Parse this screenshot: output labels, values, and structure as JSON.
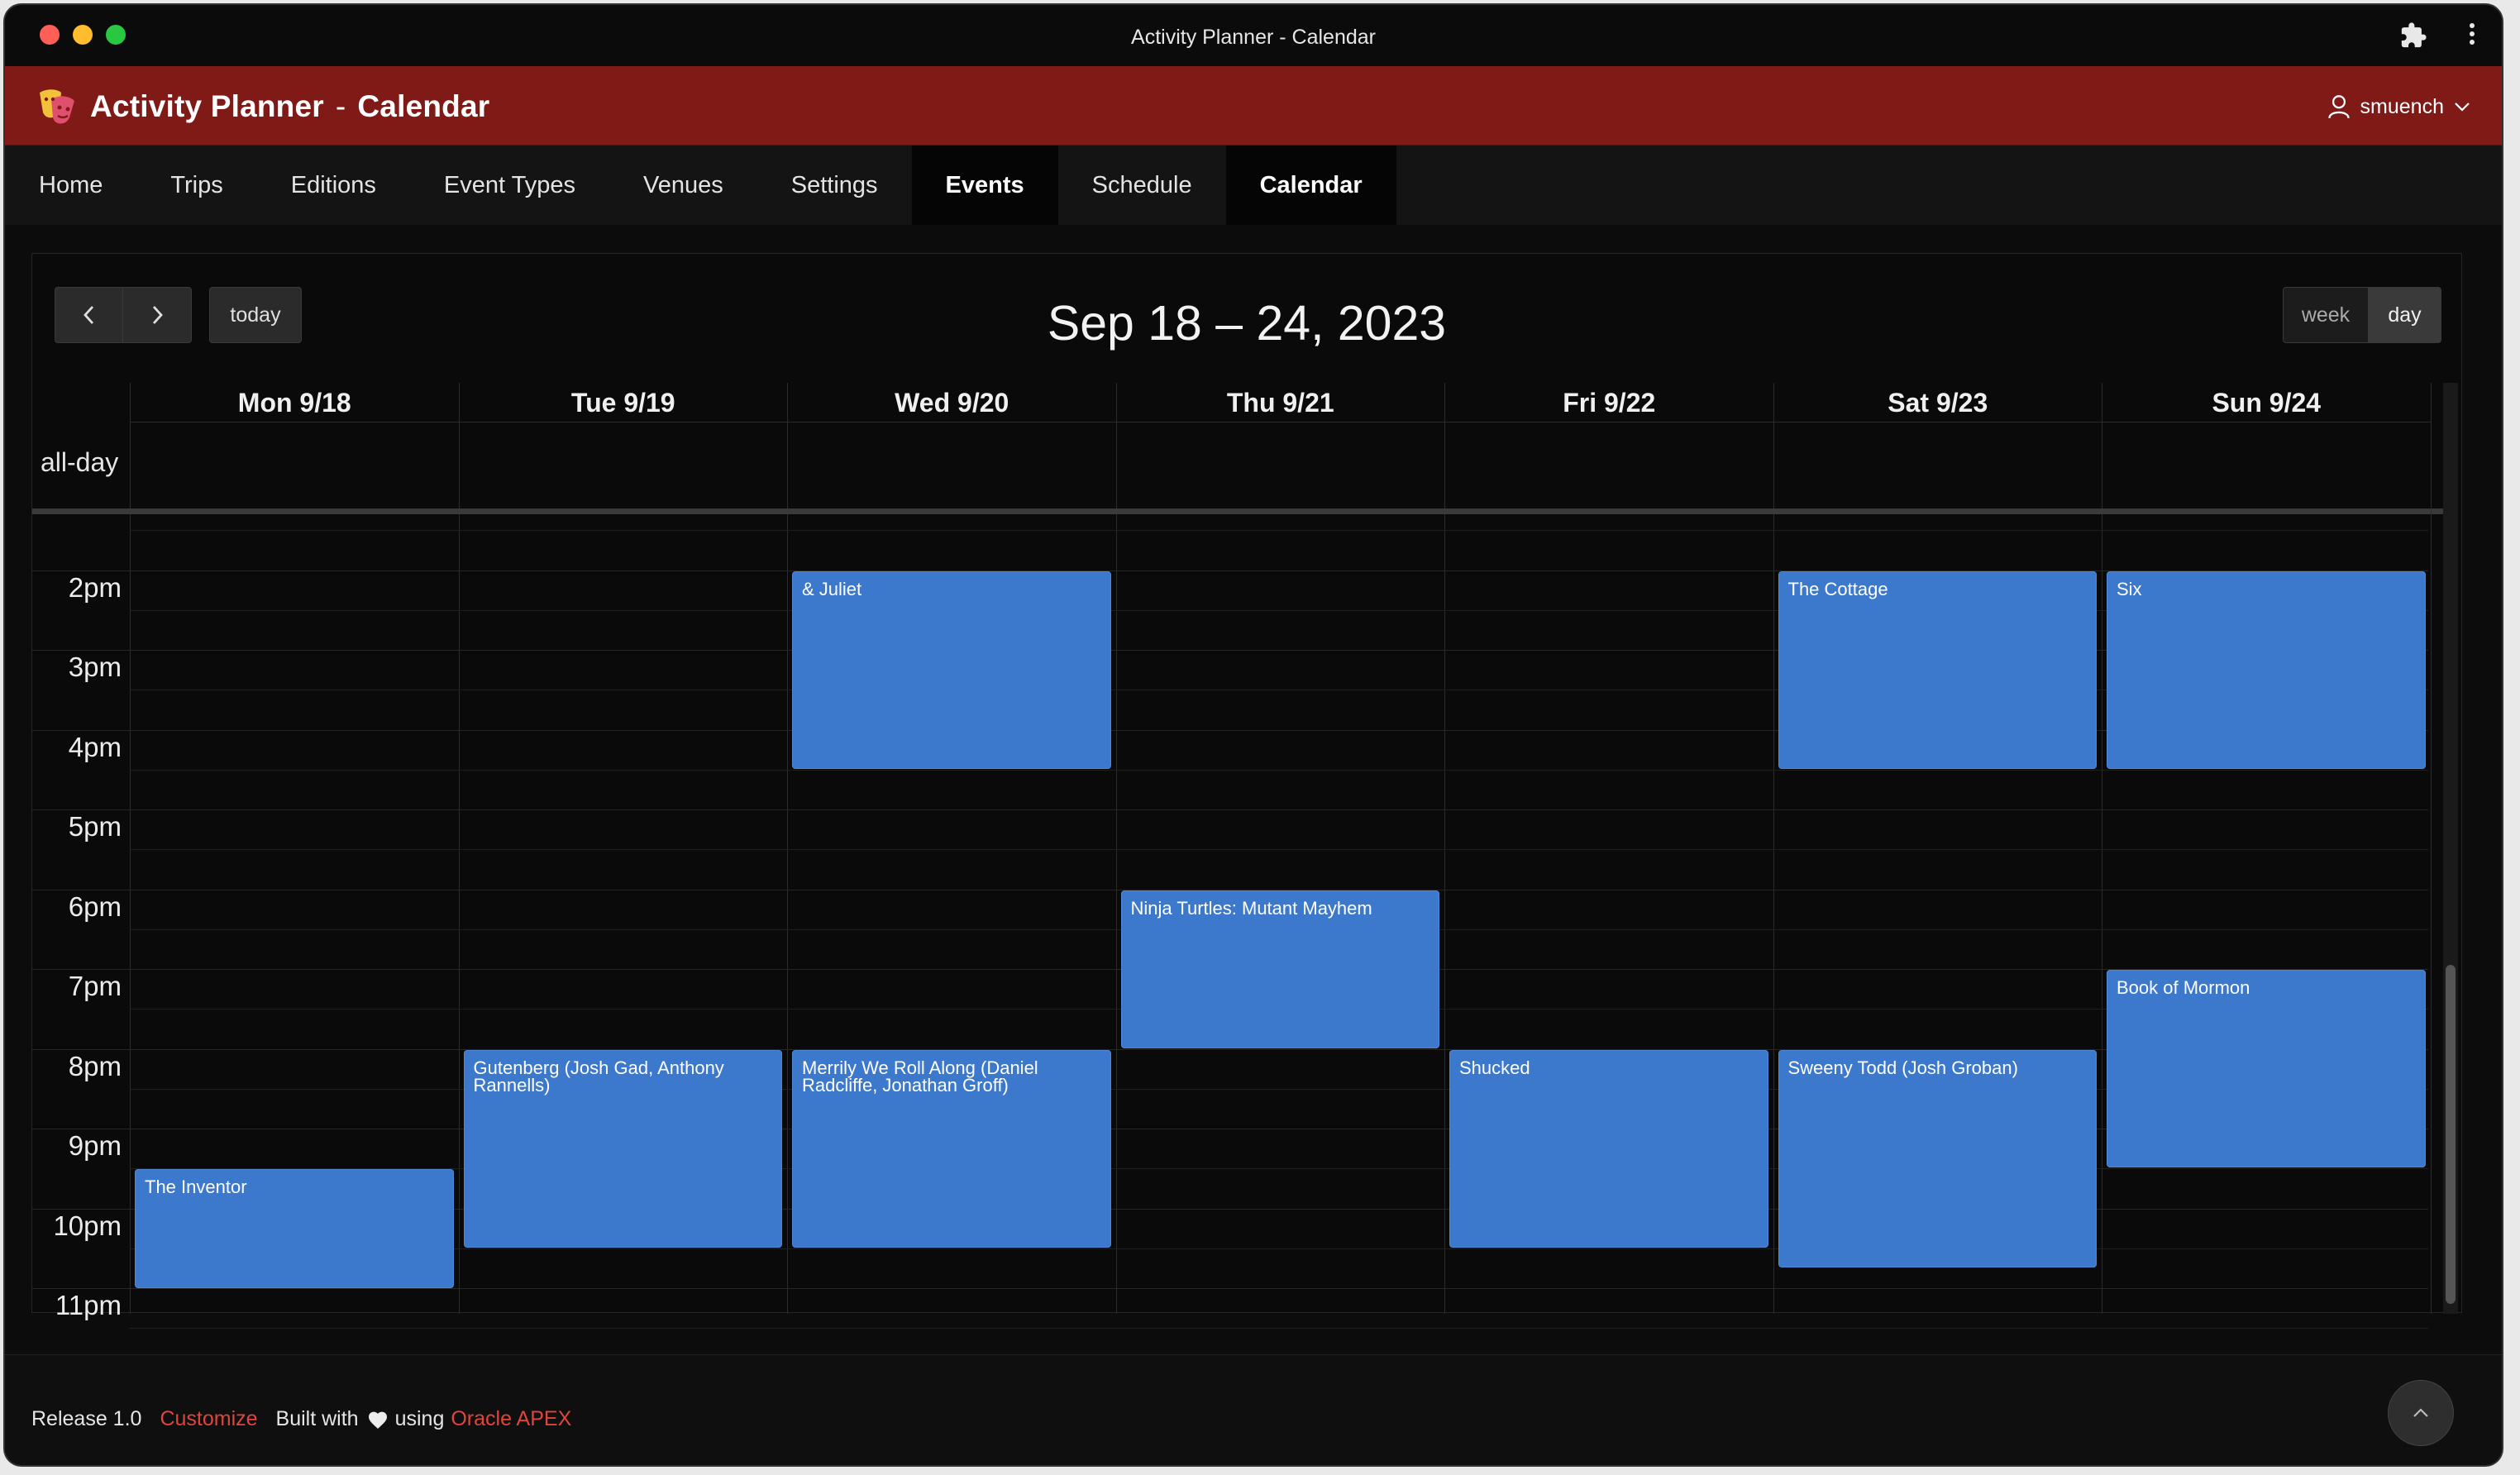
{
  "window": {
    "title": "Activity Planner - Calendar"
  },
  "header": {
    "app_name": "Activity Planner",
    "separator": "-",
    "page_name": "Calendar",
    "user": "smuench",
    "brand_color": "#7f1a16"
  },
  "nav": {
    "items": [
      {
        "label": "Home",
        "active": false
      },
      {
        "label": "Trips",
        "active": false
      },
      {
        "label": "Editions",
        "active": false
      },
      {
        "label": "Event Types",
        "active": false
      },
      {
        "label": "Venues",
        "active": false
      },
      {
        "label": "Settings",
        "active": false
      },
      {
        "label": "Events",
        "active": true
      },
      {
        "label": "Schedule",
        "active": false
      },
      {
        "label": "Calendar",
        "active": true
      }
    ]
  },
  "calendar": {
    "today_label": "today",
    "title": "Sep 18 – 24, 2023",
    "view_week": "week",
    "view_day": "day",
    "allday_label": "all-day",
    "days": [
      "Mon 9/18",
      "Tue 9/19",
      "Wed 9/20",
      "Thu 9/21",
      "Fri 9/22",
      "Sat 9/23",
      "Sun 9/24"
    ],
    "hours": [
      "2pm",
      "3pm",
      "4pm",
      "5pm",
      "6pm",
      "7pm",
      "8pm",
      "9pm",
      "10pm",
      "11pm"
    ],
    "event_color": "#3c78cc",
    "events": [
      {
        "title": "& Juliet",
        "day": 2,
        "start": 14.0,
        "end": 16.5
      },
      {
        "title": "The Cottage",
        "day": 5,
        "start": 14.0,
        "end": 16.5
      },
      {
        "title": "Six",
        "day": 6,
        "start": 14.0,
        "end": 16.5
      },
      {
        "title": "Ninja Turtles: Mutant Mayhem",
        "day": 3,
        "start": 18.0,
        "end": 20.0
      },
      {
        "title": "Book of Mormon",
        "day": 6,
        "start": 19.0,
        "end": 21.5
      },
      {
        "title": "Gutenberg (Josh Gad, Anthony Rannells)",
        "day": 1,
        "start": 20.0,
        "end": 22.5
      },
      {
        "title": "Merrily We Roll Along (Daniel Radcliffe, Jonathan Groff)",
        "day": 2,
        "start": 20.0,
        "end": 22.5
      },
      {
        "title": "Shucked",
        "day": 4,
        "start": 20.0,
        "end": 22.5
      },
      {
        "title": "Sweeny Todd (Josh Groban)",
        "day": 5,
        "start": 20.0,
        "end": 22.75
      },
      {
        "title": "The Inventor",
        "day": 0,
        "start": 21.5,
        "end": 23.15
      }
    ]
  },
  "footer": {
    "release": "Release 1.0",
    "customize": "Customize",
    "built_with": "Built with",
    "using": "using",
    "oracle": "Oracle APEX"
  }
}
